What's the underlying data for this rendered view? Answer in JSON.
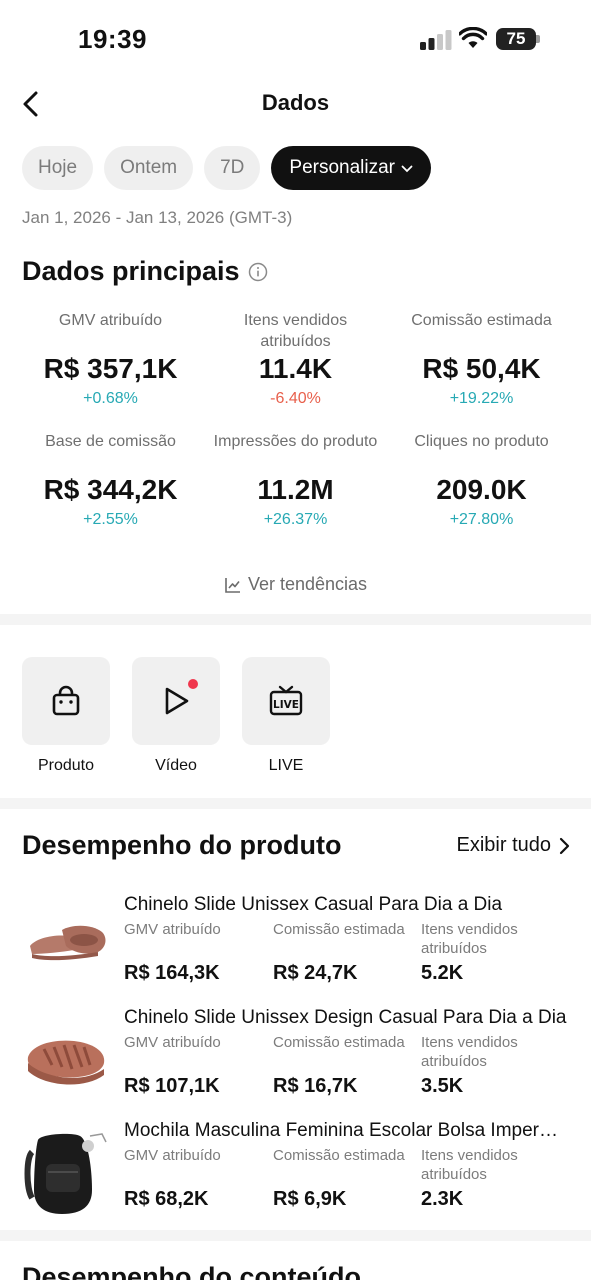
{
  "status": {
    "time": "19:39",
    "battery": "75"
  },
  "header": {
    "title": "Dados"
  },
  "filters": {
    "chips": [
      "Hoje",
      "Ontem",
      "7D"
    ],
    "active": "Personalizar",
    "range": "Jan 1, 2026 - Jan 13, 2026 (GMT-3)"
  },
  "main": {
    "title": "Dados principais",
    "metrics": [
      {
        "label": "GMV atribuído",
        "value": "R$ 357,1K",
        "change": "+0.68%",
        "trend": "up"
      },
      {
        "label": "Itens vendidos atribuídos",
        "value": "11.4K",
        "change": "-6.40%",
        "trend": "down"
      },
      {
        "label": "Comissão estimada",
        "value": "R$ 50,4K",
        "change": "+19.22%",
        "trend": "up"
      },
      {
        "label": "Base de comissão",
        "value": "R$ 344,2K",
        "change": "+2.55%",
        "trend": "up"
      },
      {
        "label": "Impressões do produto",
        "value": "11.2M",
        "change": "+26.37%",
        "trend": "up"
      },
      {
        "label": "Cliques no produto",
        "value": "209.0K",
        "change": "+27.80%",
        "trend": "up"
      }
    ],
    "trends_label": "Ver tendências"
  },
  "tiles": [
    {
      "label": "Produto",
      "icon": "shopping-bag-icon"
    },
    {
      "label": "Vídeo",
      "icon": "play-icon"
    },
    {
      "label": "LIVE",
      "icon": "live-tv-icon"
    }
  ],
  "products": {
    "title": "Desempenho do produto",
    "see_all": "Exibir tudo",
    "col_labels": [
      "GMV atribuído",
      "Comissão estimada",
      "Itens vendidos atribuídos"
    ],
    "items": [
      {
        "name": "Chinelo Slide Unissex Casual Para Dia a Dia",
        "gmv": "R$ 164,3K",
        "commission": "R$ 24,7K",
        "sold": "5.2K"
      },
      {
        "name": "Chinelo Slide Unissex Design Casual Para Dia a Dia",
        "gmv": "R$ 107,1K",
        "commission": "R$ 16,7K",
        "sold": "3.5K"
      },
      {
        "name": "Mochila Masculina Feminina Escolar Bolsa Impermeável",
        "gmv": "R$ 68,2K",
        "commission": "R$ 6,9K",
        "sold": "2.3K"
      }
    ]
  },
  "content": {
    "title": "Desempenho do conteúdo"
  }
}
